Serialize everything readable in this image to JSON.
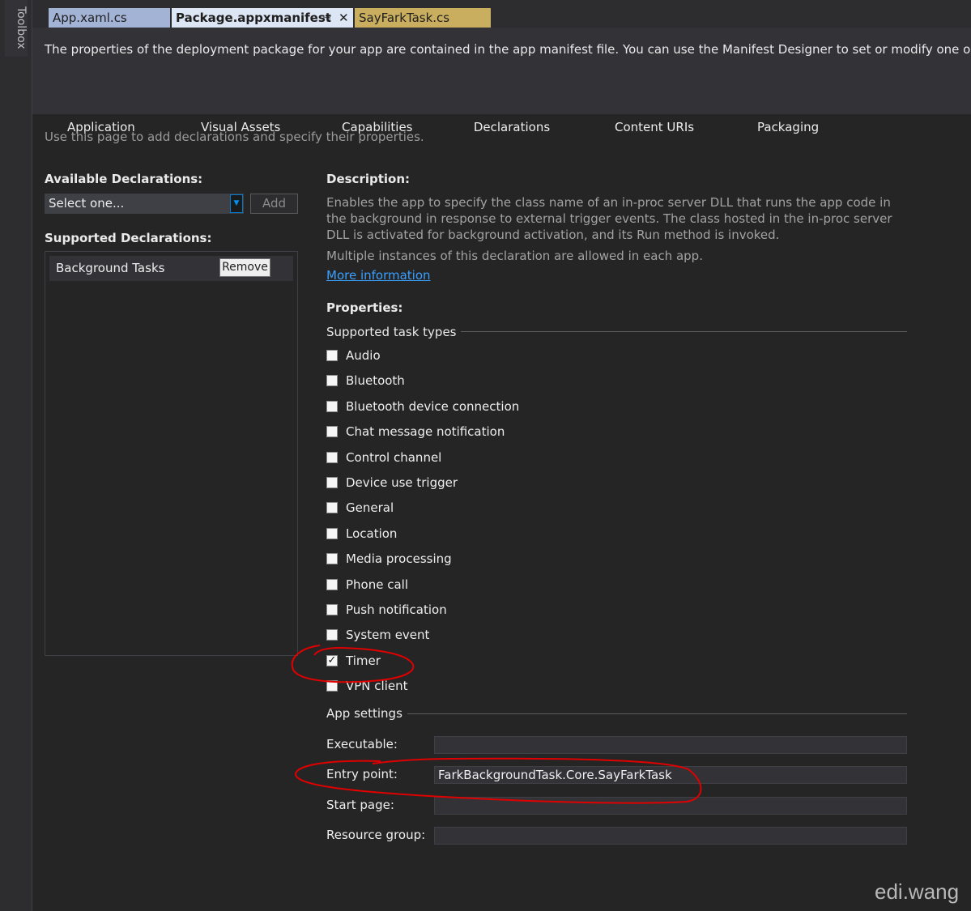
{
  "toolbox": {
    "label": "Toolbox"
  },
  "doc_tabs": [
    {
      "label": "App.xaml.cs"
    },
    {
      "label": "Package.appxmanifest",
      "pin_icon": "⊣",
      "close_icon": "✕"
    },
    {
      "label": "SayFarkTask.cs"
    }
  ],
  "info": {
    "text": "The properties of the deployment package for your app are contained in the app manifest file. You can use the Manifest Designer to set or modify one or mor"
  },
  "page_tabs": [
    "Application",
    "Visual Assets",
    "Capabilities",
    "Declarations",
    "Content URIs",
    "Packaging"
  ],
  "page_hint": "Use this page to add declarations and specify their properties.",
  "available": {
    "heading": "Available Declarations:",
    "select_value": "Select one...",
    "add_label": "Add"
  },
  "supported": {
    "heading": "Supported Declarations:",
    "items": [
      {
        "label": "Background Tasks",
        "remove_label": "Remove"
      }
    ]
  },
  "description": {
    "heading": "Description:",
    "text": "Enables the app to specify the class name of an in-proc server DLL that runs the app code in the background in response to external trigger events. The class hosted in the in-proc server DLL is activated for background activation, and its Run method is invoked.",
    "multiple": "Multiple instances of this declaration are allowed in each app.",
    "more_link": "More information"
  },
  "properties": {
    "heading": "Properties:",
    "task_types_label": "Supported task types",
    "task_types": [
      {
        "label": "Audio",
        "checked": false
      },
      {
        "label": "Bluetooth",
        "checked": false
      },
      {
        "label": "Bluetooth device connection",
        "checked": false
      },
      {
        "label": "Chat message notification",
        "checked": false
      },
      {
        "label": "Control channel",
        "checked": false
      },
      {
        "label": "Device use trigger",
        "checked": false
      },
      {
        "label": "General",
        "checked": false
      },
      {
        "label": "Location",
        "checked": false
      },
      {
        "label": "Media processing",
        "checked": false
      },
      {
        "label": "Phone call",
        "checked": false
      },
      {
        "label": "Push notification",
        "checked": false
      },
      {
        "label": "System event",
        "checked": false
      },
      {
        "label": "Timer",
        "checked": true
      },
      {
        "label": "VPN client",
        "checked": false
      }
    ],
    "app_settings_label": "App settings",
    "fields": [
      {
        "label": "Executable:",
        "value": ""
      },
      {
        "label": "Entry point:",
        "value": "FarkBackgroundTask.Core.SayFarkTask"
      },
      {
        "label": "Start page:",
        "value": ""
      },
      {
        "label": "Resource group:",
        "value": ""
      }
    ]
  },
  "watermark": "edi.wang",
  "colors": {
    "background": "#252526",
    "annotation": "#e00000",
    "link": "#3aa0ff",
    "accent": "#007acc"
  }
}
